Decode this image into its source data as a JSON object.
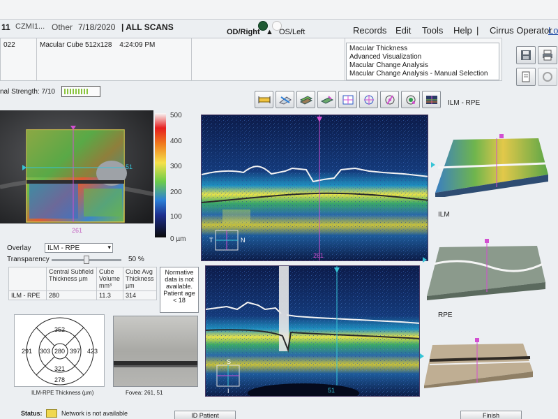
{
  "header": {
    "left_id": "11",
    "device": "CZMI1...",
    "other_label": "Other",
    "date": "7/18/2020",
    "all_scans": "| ALL SCANS",
    "od_label": "OD/Right",
    "os_label": "OS/Left",
    "operator": "Cirrus Operator",
    "logout_link": "Lo"
  },
  "menu": {
    "records": "Records",
    "edit": "Edit",
    "tools": "Tools",
    "help": "Help",
    "separator": "|"
  },
  "info": {
    "id_fragment": "022",
    "scan_type": "Macular Cube 512x128",
    "time": "4:24:09 PM"
  },
  "analysis_options": [
    "Macular Thickness",
    "Advanced Visualization",
    "Macular Change Analysis",
    "Macular Change Analysis - Manual Selection"
  ],
  "signal": {
    "label": "nal Strength: 7/10",
    "strength": 0.7
  },
  "surface_selector_label": "ILM - RPE",
  "fundus": {
    "marker_x": "261",
    "marker_y": "51"
  },
  "colorbar": {
    "ticks": [
      "500",
      "400",
      "300",
      "200",
      "100",
      "0 µm"
    ]
  },
  "bscan1": {
    "bottom_label": "261",
    "orient_t": "T",
    "orient_n": "N"
  },
  "bscan2": {
    "bottom_label": "51",
    "orient_s": "S",
    "orient_i": "I"
  },
  "surfaces": {
    "ilm": "ILM",
    "rpe": "RPE"
  },
  "overlay": {
    "label": "Overlay",
    "value": "ILM - RPE",
    "transparency_label": "Transparency",
    "transparency_value": "50 %",
    "transparency_fraction": 0.5
  },
  "table": {
    "col1": "Central Subfield Thickness µm",
    "col2": "Cube Volume mm³",
    "col3": "Cube Avg Thickness µm",
    "row_label": "ILM - RPE",
    "central": "280",
    "volume": "11.3",
    "avg": "314"
  },
  "normative": "Normative data is not available. Patient age < 18",
  "etdrs": {
    "center": "280",
    "inner_superior": "352",
    "inner_nasal": "397",
    "inner_inferior": "321",
    "inner_temporal": "303",
    "outer_superior": "",
    "outer_nasal": "423",
    "outer_inferior": "278",
    "outer_temporal": "291",
    "label": "ILM-RPE Thickness (µm)"
  },
  "fovea": {
    "label": "Fovea:",
    "coords": "261, 51"
  },
  "status": {
    "label": "Status:",
    "message": "Network is not available"
  },
  "buttons": {
    "id_patient": "ID Patient",
    "finish": "Finish"
  },
  "colors": {
    "magenta_marker": "#d34fd1",
    "cyan_marker": "#36c4d6",
    "status_yellow": "#f0d850"
  }
}
